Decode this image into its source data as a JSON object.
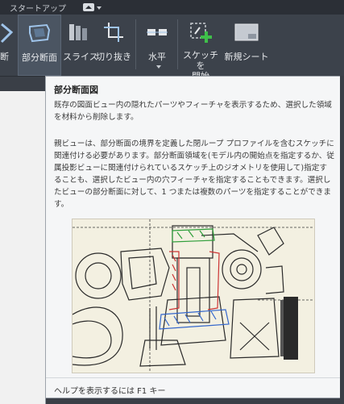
{
  "titlebar": {
    "tab_label": "スタートアップ"
  },
  "ribbon": {
    "buttons": [
      {
        "label": "断"
      },
      {
        "label": "部分断面"
      },
      {
        "label": "スライス"
      },
      {
        "label": "切り抜き"
      },
      {
        "label": "水平"
      },
      {
        "label": "スケッチを\n開始"
      },
      {
        "label": "新規シート"
      }
    ]
  },
  "tooltip": {
    "title": "部分断面図",
    "para1": "既存の図面ビュー内の隠れたパーツやフィーチャを表示するため、選択した領域を材料から削除します。",
    "para2": "親ビューは、部分断面の境界を定義した閉ループ プロファイルを含むスケッチに関連付ける必要があります。部分断面領域を(モデル内の開始点を指定するか、従属投影ビューに関連付けられているスケッチ上のジオメトリを使用して)指定することも、選択したビュー内の穴フィーチャを指定することもできます。選択したビューの部分断面に対して、1 つまたは複数のパーツを指定することができます。",
    "footer": "ヘルプを表示するには F1 キー"
  },
  "colors": {
    "accent": "#3fbf4a",
    "tooltip_bg": "#f5f6f7",
    "ribbon_bg": "#3c424b"
  }
}
